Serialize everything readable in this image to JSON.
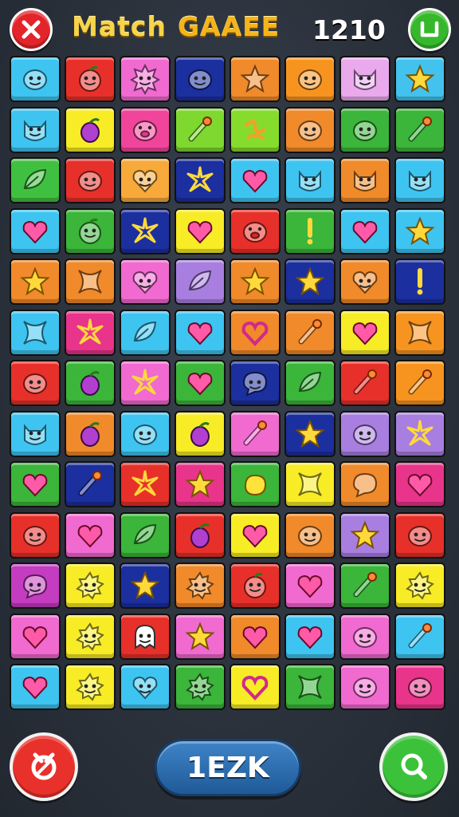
{
  "header": {
    "title_word1": "Match",
    "title_word2": "GAAEE",
    "score": "1210",
    "close_icon": "close-x-icon",
    "menu_icon": "menu-bracket-icon"
  },
  "board": {
    "rows": [
      [
        {
          "color": "#3ec4f0",
          "icon": "blob-face"
        },
        {
          "color": "#e8302a",
          "icon": "fruit-face"
        },
        {
          "color": "#f06ad0",
          "icon": "sun-face"
        },
        {
          "color": "#1c2f9e",
          "icon": "blob-face"
        },
        {
          "color": "#f08a2a",
          "icon": "star-face"
        },
        {
          "color": "#f79420",
          "icon": "blob-face"
        },
        {
          "color": "#e9a9ec",
          "icon": "cat-face"
        },
        {
          "color": "#42c2ec",
          "icon": "star"
        }
      ],
      [
        {
          "color": "#3ec4f0",
          "icon": "cat-face"
        },
        {
          "color": "#f7ec26",
          "icon": "fruit"
        },
        {
          "color": "#f0459a",
          "icon": "pig-face"
        },
        {
          "color": "#7ed830",
          "icon": "brush"
        },
        {
          "color": "#86dc2c",
          "icon": "squiggle"
        },
        {
          "color": "#f08a2a",
          "icon": "blob-face"
        },
        {
          "color": "#3bb53a",
          "icon": "blob-face"
        },
        {
          "color": "#3bb53a",
          "icon": "brush"
        }
      ],
      [
        {
          "color": "#40c040",
          "icon": "leaf"
        },
        {
          "color": "#e8302a",
          "icon": "blob-face"
        },
        {
          "color": "#f7a93a",
          "icon": "heart-face"
        },
        {
          "color": "#1c2f9e",
          "icon": "sparkle-star"
        },
        {
          "color": "#3ec4f0",
          "icon": "heart"
        },
        {
          "color": "#3ec4f0",
          "icon": "cat-face"
        },
        {
          "color": "#f08a2a",
          "icon": "cat-face"
        },
        {
          "color": "#3ec4f0",
          "icon": "cat-face"
        }
      ],
      [
        {
          "color": "#3ec4f0",
          "icon": "heart"
        },
        {
          "color": "#3bb53a",
          "icon": "fruit-face"
        },
        {
          "color": "#1c2f9e",
          "icon": "sparkle-star"
        },
        {
          "color": "#f7ec26",
          "icon": "heart"
        },
        {
          "color": "#e8302a",
          "icon": "pig-face"
        },
        {
          "color": "#3bb53a",
          "icon": "exclamation"
        },
        {
          "color": "#3ec4f0",
          "icon": "heart"
        },
        {
          "color": "#3ec4f0",
          "icon": "star"
        }
      ],
      [
        {
          "color": "#f08a2a",
          "icon": "star"
        },
        {
          "color": "#f08a2a",
          "icon": "cross-star"
        },
        {
          "color": "#f06ad0",
          "icon": "heart-face"
        },
        {
          "color": "#a87fe0",
          "icon": "leaf"
        },
        {
          "color": "#f08a2a",
          "icon": "star"
        },
        {
          "color": "#1c2f9e",
          "icon": "star"
        },
        {
          "color": "#f08a2a",
          "icon": "heart-face"
        },
        {
          "color": "#1c2f9e",
          "icon": "exclamation"
        }
      ],
      [
        {
          "color": "#3ec4f0",
          "icon": "cross-star"
        },
        {
          "color": "#e8348a",
          "icon": "sparkle-star"
        },
        {
          "color": "#3ec4f0",
          "icon": "leaf"
        },
        {
          "color": "#3ec4f0",
          "icon": "heart"
        },
        {
          "color": "#f08a2a",
          "icon": "heart-outline"
        },
        {
          "color": "#f08a2a",
          "icon": "brush"
        },
        {
          "color": "#f7ec26",
          "icon": "heart"
        },
        {
          "color": "#f79420",
          "icon": "cross-star"
        }
      ],
      [
        {
          "color": "#e8302a",
          "icon": "blob-face"
        },
        {
          "color": "#3bb53a",
          "icon": "fruit"
        },
        {
          "color": "#f06ad0",
          "icon": "sparkle-star"
        },
        {
          "color": "#3bb53a",
          "icon": "heart"
        },
        {
          "color": "#1c2f9e",
          "icon": "chat-face"
        },
        {
          "color": "#3bb53a",
          "icon": "leaf"
        },
        {
          "color": "#e8302a",
          "icon": "brush"
        },
        {
          "color": "#f79420",
          "icon": "brush"
        }
      ],
      [
        {
          "color": "#3ec4f0",
          "icon": "cat-face"
        },
        {
          "color": "#f08a2a",
          "icon": "fruit"
        },
        {
          "color": "#3ec4f0",
          "icon": "blob-face"
        },
        {
          "color": "#f7ec26",
          "icon": "fruit"
        },
        {
          "color": "#f06ad0",
          "icon": "brush"
        },
        {
          "color": "#1c2f9e",
          "icon": "star"
        },
        {
          "color": "#a87fe0",
          "icon": "blob-face"
        },
        {
          "color": "#a87fe0",
          "icon": "sparkle-star"
        }
      ],
      [
        {
          "color": "#3bb53a",
          "icon": "heart"
        },
        {
          "color": "#1c2f9e",
          "icon": "brush"
        },
        {
          "color": "#e8302a",
          "icon": "sparkle-star"
        },
        {
          "color": "#e8348a",
          "icon": "star"
        },
        {
          "color": "#3bb53a",
          "icon": "blob"
        },
        {
          "color": "#f7ec26",
          "icon": "cross-star"
        },
        {
          "color": "#f08a2a",
          "icon": "chat"
        },
        {
          "color": "#e8348a",
          "icon": "heart"
        }
      ],
      [
        {
          "color": "#e8302a",
          "icon": "blob-face"
        },
        {
          "color": "#f06ad0",
          "icon": "heart"
        },
        {
          "color": "#3bb53a",
          "icon": "leaf"
        },
        {
          "color": "#e8302a",
          "icon": "fruit"
        },
        {
          "color": "#f7ec26",
          "icon": "heart"
        },
        {
          "color": "#f08a2a",
          "icon": "blob-face"
        },
        {
          "color": "#a87fe0",
          "icon": "star"
        },
        {
          "color": "#e8302a",
          "icon": "blob-face"
        }
      ],
      [
        {
          "color": "#c43cc0",
          "icon": "chat-face"
        },
        {
          "color": "#f7ec26",
          "icon": "spiky-face"
        },
        {
          "color": "#1c2f9e",
          "icon": "star"
        },
        {
          "color": "#f08a2a",
          "icon": "spiky-face"
        },
        {
          "color": "#e8302a",
          "icon": "fruit-face"
        },
        {
          "color": "#f06ad0",
          "icon": "heart"
        },
        {
          "color": "#3bb53a",
          "icon": "brush"
        },
        {
          "color": "#f7ec26",
          "icon": "spiky-face"
        }
      ],
      [
        {
          "color": "#f06ad0",
          "icon": "heart"
        },
        {
          "color": "#f7ec26",
          "icon": "spiky-face"
        },
        {
          "color": "#e8302a",
          "icon": "ghost-face"
        },
        {
          "color": "#f06ad0",
          "icon": "star"
        },
        {
          "color": "#f08a2a",
          "icon": "heart"
        },
        {
          "color": "#3ec4f0",
          "icon": "heart"
        },
        {
          "color": "#f06ad0",
          "icon": "blob-face"
        },
        {
          "color": "#3ec4f0",
          "icon": "brush"
        }
      ],
      [
        {
          "color": "#3ec4f0",
          "icon": "heart"
        },
        {
          "color": "#f7ec26",
          "icon": "spiky-face"
        },
        {
          "color": "#3ec4f0",
          "icon": "heart-face"
        },
        {
          "color": "#3bb53a",
          "icon": "spiky-face"
        },
        {
          "color": "#f7ec26",
          "icon": "heart-outline"
        },
        {
          "color": "#3bb53a",
          "icon": "cross-star"
        },
        {
          "color": "#f06ad0",
          "icon": "blob-face"
        },
        {
          "color": "#e8348a",
          "icon": "blob-face"
        }
      ]
    ]
  },
  "footer": {
    "left_button_icon": "swap-cycle-icon",
    "center_button_label": "1EZK",
    "right_button_icon": "search-magnifier-icon"
  }
}
